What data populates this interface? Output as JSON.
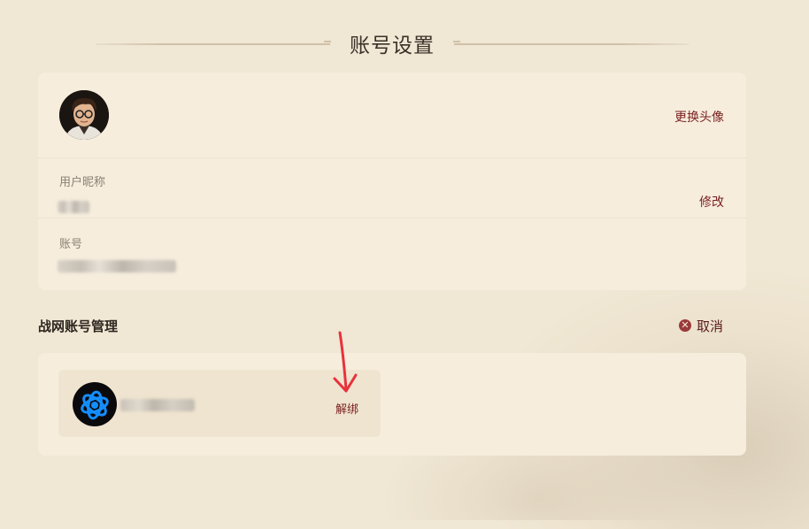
{
  "page": {
    "title": "账号设置"
  },
  "profile": {
    "change_avatar_label": "更换头像",
    "nickname_label": "用户昵称",
    "nickname_value": "",
    "modify_label": "修改",
    "account_label": "账号",
    "account_value": ""
  },
  "battlenet": {
    "section_title": "战网账号管理",
    "cancel_label": "取消",
    "account_name": "",
    "unbind_label": "解绑"
  },
  "colors": {
    "accent": "#7a1f1f",
    "background": "#f0e7d4",
    "card": "#f6eddd",
    "annotation_arrow": "#e8323c",
    "battlenet_blue": "#148eff"
  },
  "icons": {
    "cancel": "close-circle-icon",
    "battlenet": "battlenet-logo-icon",
    "annotation": "red-arrow-down-icon"
  }
}
